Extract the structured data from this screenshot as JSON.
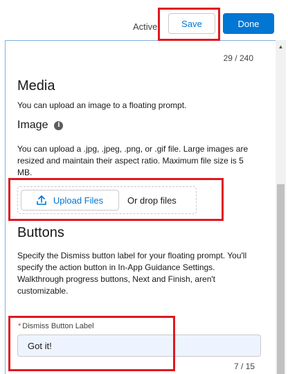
{
  "header": {
    "status_label": "Active",
    "save_label": "Save",
    "done_label": "Done"
  },
  "form": {
    "title_counter": "29 / 240",
    "media": {
      "heading": "Media",
      "description": "You can upload an image to a floating prompt."
    },
    "image": {
      "heading": "Image",
      "description": "You can upload a .jpg, .jpeg, .png, or .gif file. Large images are resized and maintain their aspect ratio. Maximum file size is 5 MB.",
      "upload_label": "Upload Files",
      "drop_label": "Or drop files"
    },
    "buttons": {
      "heading": "Buttons",
      "description": "Specify the Dismiss button label for your floating prompt. You'll specify the action button in In-App Guidance Settings. Walkthrough progress buttons, Next and Finish, aren't customizable."
    },
    "dismiss": {
      "required_marker": "*",
      "label": "Dismiss Button Label",
      "value": "Got it!",
      "counter": "7 / 15"
    }
  },
  "colors": {
    "brand": "#0176d3",
    "highlight": "#e0181f"
  }
}
